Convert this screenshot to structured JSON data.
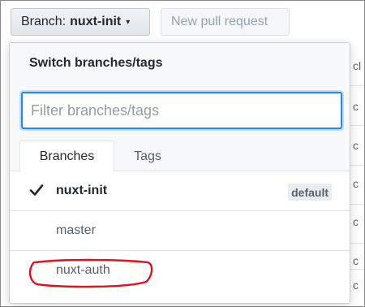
{
  "toolbar": {
    "branch_prefix": "Branch:",
    "branch_name": "nuxt-init",
    "caret": "▾",
    "new_pr_label": "New pull request"
  },
  "background_table": {
    "cells": [
      "cl",
      "c",
      "c",
      "c",
      "c",
      "c",
      "c"
    ]
  },
  "menu": {
    "title": "Switch branches/tags",
    "filter_placeholder": "Filter branches/tags",
    "filter_value": "",
    "tabs": [
      {
        "label": "Branches",
        "active": true
      },
      {
        "label": "Tags",
        "active": false
      }
    ],
    "items": [
      {
        "label": "nuxt-init",
        "selected": true,
        "badge": "default"
      },
      {
        "label": "master",
        "selected": false
      },
      {
        "label": "nuxt-auth",
        "selected": false,
        "annotated": true
      }
    ]
  },
  "colors": {
    "focus_ring": "#2188ff",
    "annotation": "#e0121a"
  },
  "icons": [
    "caret-down-icon",
    "check-icon"
  ]
}
